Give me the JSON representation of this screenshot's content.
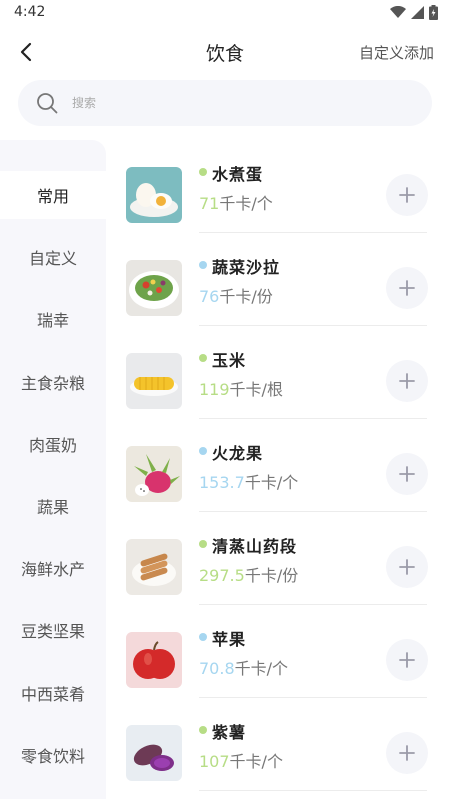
{
  "status_bar": {
    "time": "4:42"
  },
  "header": {
    "title": "饮食",
    "custom_add": "自定义添加"
  },
  "search": {
    "placeholder": "搜索"
  },
  "sidebar": {
    "items": [
      {
        "label": "常用",
        "active": true
      },
      {
        "label": "自定义"
      },
      {
        "label": "瑞幸"
      },
      {
        "label": "主食杂粮"
      },
      {
        "label": "肉蛋奶"
      },
      {
        "label": "蔬果"
      },
      {
        "label": "海鲜水产"
      },
      {
        "label": "豆类坚果"
      },
      {
        "label": "中西菜肴"
      },
      {
        "label": "零食饮料"
      }
    ]
  },
  "foods": [
    {
      "name": "水煮蛋",
      "calories": "71",
      "unit": "千卡/个",
      "dot_color": "#b7dd86"
    },
    {
      "name": "蔬菜沙拉",
      "calories": "76",
      "unit": "千卡/份",
      "dot_color": "#a6d6f0"
    },
    {
      "name": "玉米",
      "calories": "119",
      "unit": "千卡/根",
      "dot_color": "#b7dd86"
    },
    {
      "name": "火龙果",
      "calories": "153.7",
      "unit": "千卡/个",
      "dot_color": "#a6d6f0"
    },
    {
      "name": "清蒸山药段",
      "calories": "297.5",
      "unit": "千卡/份",
      "dot_color": "#b7dd86"
    },
    {
      "name": "苹果",
      "calories": "70.8",
      "unit": "千卡/个",
      "dot_color": "#a6d6f0"
    },
    {
      "name": "紫薯",
      "calories": "107",
      "unit": "千卡/个",
      "dot_color": "#b7dd86"
    }
  ],
  "colors": {
    "green": "#b7dd86",
    "blue": "#a6d6f0",
    "sidebar_bg": "#f7f7fb"
  }
}
